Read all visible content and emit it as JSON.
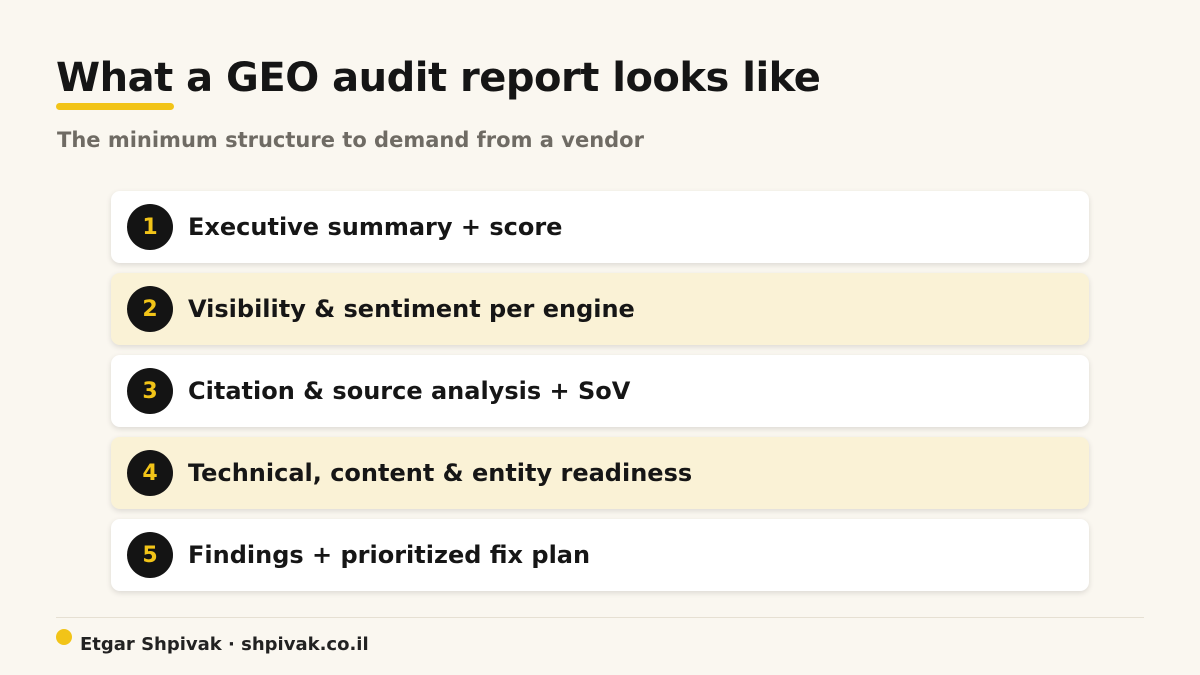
{
  "header": {
    "title": "What a GEO audit report looks like",
    "subtitle": "The minimum structure to demand from a vendor"
  },
  "items": [
    {
      "number": "1",
      "label": "Executive summary + score",
      "highlighted": false
    },
    {
      "number": "2",
      "label": "Visibility & sentiment per engine",
      "highlighted": true
    },
    {
      "number": "3",
      "label": "Citation & source analysis + SoV",
      "highlighted": false
    },
    {
      "number": "4",
      "label": "Technical, content & entity readiness",
      "highlighted": true
    },
    {
      "number": "5",
      "label": "Findings + prioritized fix plan",
      "highlighted": false
    }
  ],
  "footer": {
    "credit": "Etgar Shpivak · shpivak.co.il"
  },
  "colors": {
    "background": "#faf7f0",
    "accent": "#f2c418",
    "card": "#ffffff",
    "card_highlight": "#faf2d6",
    "badge": "#141414"
  }
}
